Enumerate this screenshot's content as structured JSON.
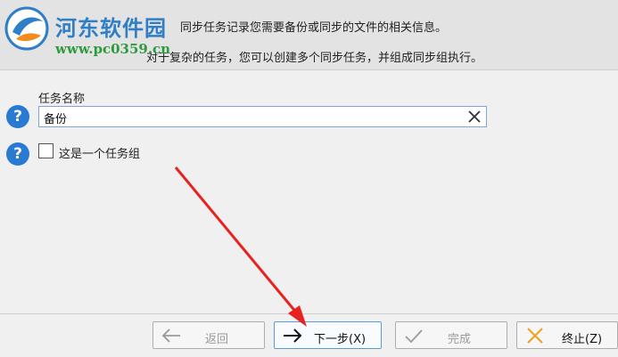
{
  "header": {
    "line1": "同步任务记录您需要备份或同步的文件的相关信息。",
    "line2": "对于复杂的任务，您可以创建多个同步任务，并组成同步组执行。"
  },
  "watermark": {
    "brand": "河东软件园",
    "url": "www.pc0359.cn"
  },
  "form": {
    "task_name_label": "任务名称",
    "task_name_value": "备份",
    "group_checkbox_label": "这是一个任务组",
    "group_checkbox_checked": false,
    "help_symbol": "?"
  },
  "buttons": {
    "back": "返回",
    "next": "下一步(X)",
    "finish": "完成",
    "terminate": "终止(Z)"
  },
  "colors": {
    "accent": "#2a7ad2",
    "annotation": "#e8231f"
  }
}
